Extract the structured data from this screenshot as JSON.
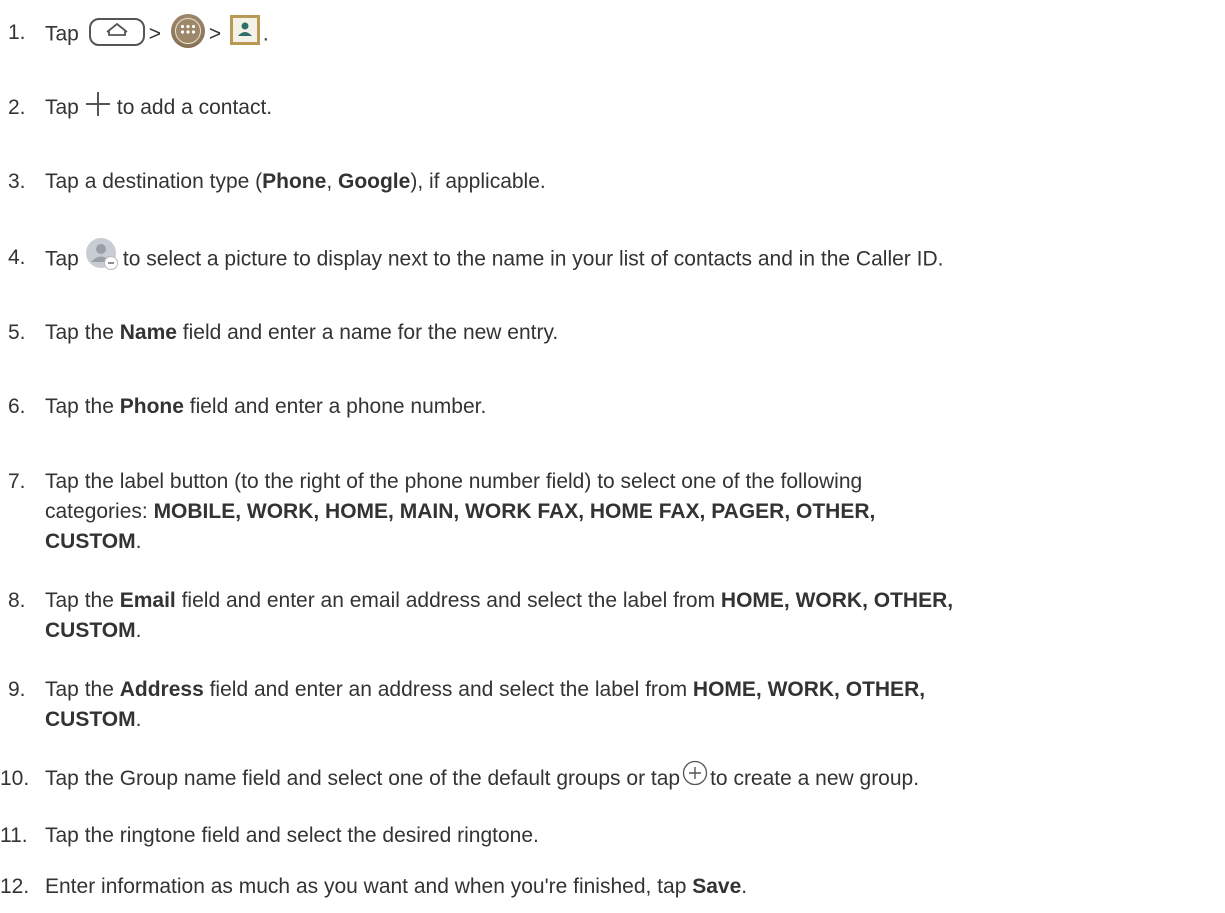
{
  "steps": [
    {
      "num": "1.",
      "prefix": "Tap",
      "sep1": ">",
      "sep2": ">",
      "suffix": "."
    },
    {
      "num": "2.",
      "prefix": "Tap",
      "suffix": "to add a contact."
    },
    {
      "num": "3.",
      "text1": "Tap a destination type (",
      "bold1": "Phone",
      "text2": ", ",
      "bold2": "Google",
      "text3": "), if applicable."
    },
    {
      "num": "4.",
      "prefix": "Tap",
      "suffix": "to select a picture to display next to the name in your list of contacts and in the Caller ID."
    },
    {
      "num": "5.",
      "text1": "Tap the ",
      "bold1": "Name",
      "text2": " field and enter a name for the new entry."
    },
    {
      "num": "6.",
      "text1": "Tap the ",
      "bold1": "Phone",
      "text2": " field and enter a phone number."
    },
    {
      "num": "7.",
      "line1": "Tap the label button (to the right of the phone number field) to select one of the following",
      "text1": "categories: ",
      "bold1": "MOBILE, WORK, HOME, MAIN, WORK FAX, HOME FAX, PAGER, OTHER,",
      "bold2": "CUSTOM",
      "text2": "."
    },
    {
      "num": "8.",
      "text1": "Tap the ",
      "bold1": "Email",
      "text2": " field and enter an email address and select the label from ",
      "bold2": "HOME, WORK, OTHER,",
      "bold3": "CUSTOM",
      "text3": "."
    },
    {
      "num": "9.",
      "text1": "Tap the ",
      "bold1": "Address",
      "text2": " field and enter an address and select the label from ",
      "bold2": "HOME, WORK, OTHER,",
      "bold3": "CUSTOM",
      "text3": "."
    },
    {
      "num": "10.",
      "text1": "Tap the Group name field and select one of the default groups or tap",
      "text2": "to create a new group."
    },
    {
      "num": "11.",
      "text1": "Tap the ringtone field and select the desired ringtone."
    },
    {
      "num": "12.",
      "text1": "Enter information as much as you want and when you're finished, tap ",
      "bold1": "Save",
      "text2": "."
    }
  ],
  "icons": {
    "home": "home-key-icon",
    "apps": "apps-icon",
    "contacts": "contacts-app-icon",
    "add": "plus-icon",
    "photo": "contact-photo-icon",
    "add_group": "circle-plus-icon"
  },
  "colors": {
    "text": "#333333",
    "apps_icon": "#8a7458",
    "contacts_icon_frame": "#b99a55"
  }
}
